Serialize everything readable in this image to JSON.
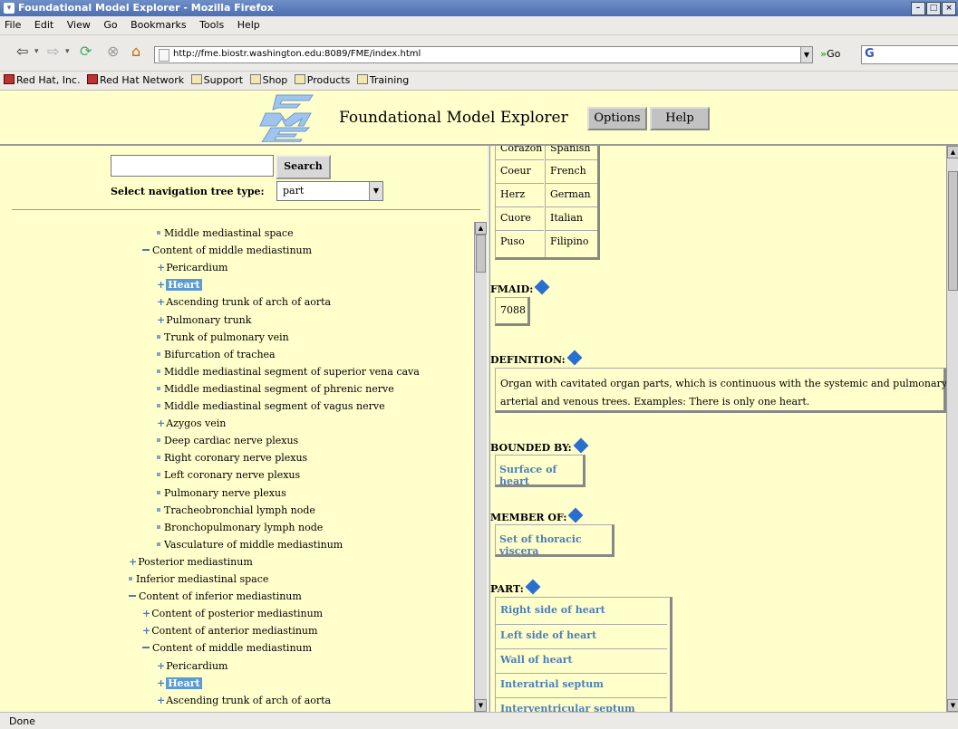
{
  "window": {
    "title": "Foundational Model Explorer - Mozilla Firefox"
  },
  "menu": [
    "File",
    "Edit",
    "View",
    "Go",
    "Bookmarks",
    "Tools",
    "Help"
  ],
  "browser": {
    "url": "http://fme.biostr.washington.edu:8089/FME/index.html",
    "go_label": "Go"
  },
  "bookmarks": [
    "Red Hat, Inc.",
    "Red Hat Network",
    "Support",
    "Shop",
    "Products",
    "Training"
  ],
  "header": {
    "title": "Foundational Model Explorer",
    "options_label": "Options",
    "help_label": "Help"
  },
  "left": {
    "search_label": "Search",
    "search_value": "",
    "select_label": "Select navigation tree type:",
    "select_value": "part"
  },
  "tree": [
    {
      "label": "Middle mediastinal space",
      "icon": "square"
    },
    {
      "label": "Content of middle mediastinum",
      "icon": "minus"
    },
    {
      "label": "Pericardium",
      "icon": "plus"
    },
    {
      "label": "Heart",
      "icon": "plus"
    },
    {
      "label": "Ascending trunk of arch of aorta",
      "icon": "plus"
    },
    {
      "label": "Pulmonary trunk",
      "icon": "plus"
    },
    {
      "label": "Trunk of pulmonary vein",
      "icon": "square"
    },
    {
      "label": "Bifurcation of trachea",
      "icon": "square"
    },
    {
      "label": "Middle mediastinal segment of superior vena cava",
      "icon": "square"
    },
    {
      "label": "Middle mediastinal segment of phrenic nerve",
      "icon": "square"
    },
    {
      "label": "Middle mediastinal segment of vagus nerve",
      "icon": "square"
    },
    {
      "label": "Azygos vein",
      "icon": "plus"
    },
    {
      "label": "Deep cardiac nerve plexus",
      "icon": "square"
    },
    {
      "label": "Right coronary nerve plexus",
      "icon": "square"
    },
    {
      "label": "Left coronary nerve plexus",
      "icon": "square"
    },
    {
      "label": "Pulmonary nerve plexus",
      "icon": "square"
    },
    {
      "label": "Tracheobronchial lymph node",
      "icon": "square"
    },
    {
      "label": "Bronchopulmonary lymph node",
      "icon": "square"
    },
    {
      "label": "Vasculature of middle mediastinum",
      "icon": "square"
    },
    {
      "label": "Posterior mediastinum",
      "icon": "plus"
    },
    {
      "label": "Inferior mediastinal space",
      "icon": "square"
    },
    {
      "label": "Content of inferior mediastinum",
      "icon": "minus"
    },
    {
      "label": "Content of posterior mediastinum",
      "icon": "plus"
    },
    {
      "label": "Content of anterior mediastinum",
      "icon": "plus"
    },
    {
      "label": "Content of middle mediastinum",
      "icon": "minus"
    },
    {
      "label": "Pericardium",
      "icon": "plus"
    },
    {
      "label": "Heart",
      "icon": "plus"
    },
    {
      "label": "Ascending trunk of arch of aorta",
      "icon": "plus"
    }
  ],
  "synonyms": [
    {
      "term": "Corazon",
      "lang": "Spanish"
    },
    {
      "term": "Coeur",
      "lang": "French"
    },
    {
      "term": "Herz",
      "lang": "German"
    },
    {
      "term": "Cuore",
      "lang": "Italian"
    },
    {
      "term": "Puso",
      "lang": "Filipino"
    }
  ],
  "fmaid": {
    "label": "FMAID:",
    "value": "7088"
  },
  "definition": {
    "label": "DEFINITION:",
    "line1": "Organ with cavitated organ parts, which is continuous with the systemic and pulmonary",
    "line2": "arterial and venous trees. Examples: There is only one heart."
  },
  "bounded_by": {
    "label": "BOUNDED BY:",
    "value": "Surface of heart"
  },
  "member_of": {
    "label": "MEMBER OF:",
    "value": "Set of thoracic viscera"
  },
  "part": {
    "label": "PART:",
    "items": [
      "Right side of heart",
      "Left side of heart",
      "Wall of heart",
      "Interatrial septum",
      "Interventricular septum"
    ]
  },
  "status": "Done"
}
